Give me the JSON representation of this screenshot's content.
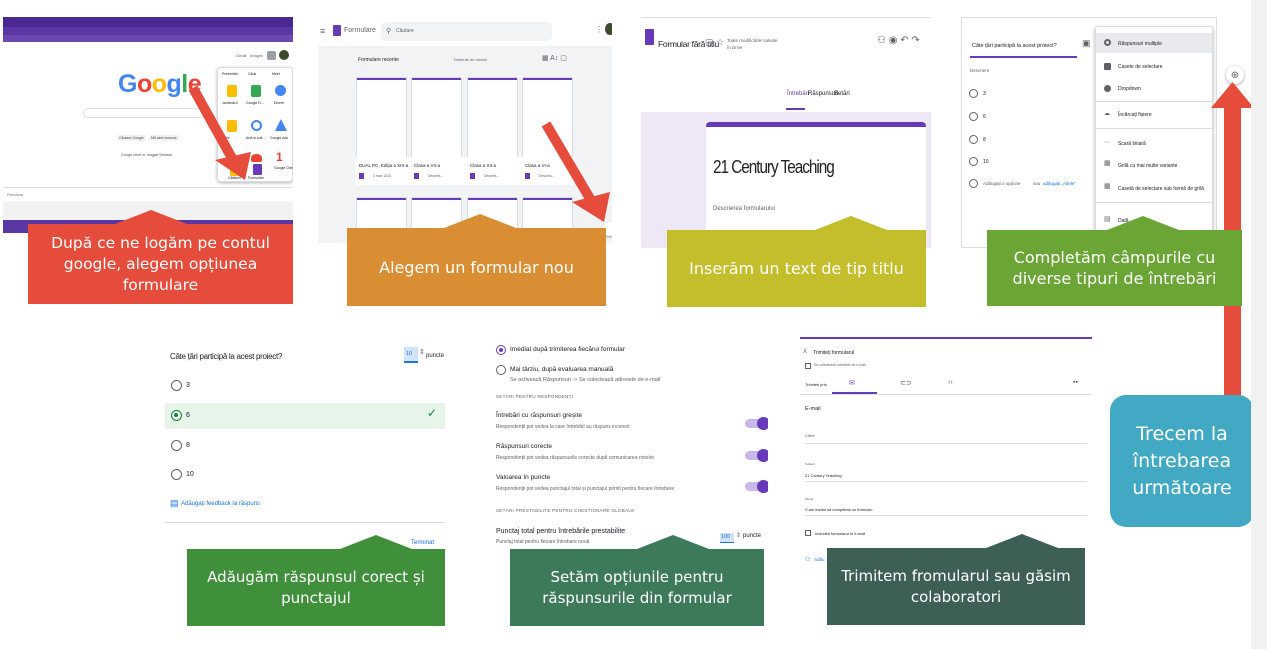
{
  "colors": {
    "red": "#e64c3c",
    "orange": "#d98e33",
    "yellow": "#c4be2c",
    "green": "#6aa535",
    "green2": "#3f8f3b",
    "teal": "#3d7a5a",
    "slate": "#3e5f55",
    "blue": "#42a9c4",
    "purple": "#673ab7"
  },
  "captions": {
    "step1": [
      "După ce ne logăm pe contul",
      "google, alegem opțiunea",
      "formulare"
    ],
    "step2": "Alegem un formular nou",
    "step3": "Inserăm un text de tip titlu",
    "step4": [
      "Completăm câmpurile cu",
      "diverse tipuri de întrebări"
    ],
    "step5": [
      "Trecem la",
      "întrebarea",
      "următoare"
    ],
    "step6": [
      "Adăugăm răspunsul corect și",
      "punctajul"
    ],
    "step7": [
      "Setăm opțiunile pentru",
      "răspunsurile din formular"
    ],
    "step8": [
      "Trimitem fromularul sau găsim",
      "colaboratori"
    ]
  },
  "shot1": {
    "logo": [
      "G",
      "o",
      "o",
      "g",
      "l",
      "e"
    ],
    "search_btn": "Căutare Google",
    "lucky_btn": "Mă simt norocos",
    "lang_text": "Google oferit în: magyar Deutsch",
    "country": "România",
    "apps": [
      "Prezentări",
      "Căuți",
      "Meet",
      "Jamboard",
      "Google D...",
      "Diverti",
      "Hărți",
      "Artă și cult...",
      "Google Ads",
      "Google One",
      "Călătorii",
      "Formulare"
    ],
    "top_links": [
      "Gmail",
      "Imagini"
    ]
  },
  "shot2": {
    "app_name": "Formulare",
    "search_placeholder": "Căutare",
    "section": "Formulare recente",
    "owner_filter": "Deținute de oricine",
    "forms": [
      {
        "title": "DUAL PC, Ediția a XIX-a",
        "date": "3 mar. 2021"
      },
      {
        "title": "Clasa a VII-a",
        "date": "Deschis..."
      },
      {
        "title": "Clasa a XII-a",
        "date": "Deschis..."
      },
      {
        "title": "Clasa a VI-a",
        "date": "Deschis..."
      }
    ]
  },
  "shot3": {
    "doc_title": "Formular fără titlu",
    "save_status": "Toate modificările salvate în Drive",
    "tabs": [
      "Întrebări",
      "Răspunsuri",
      "Setări"
    ],
    "form_title": "21 Century Teaching",
    "form_desc": "Descrierea formularului"
  },
  "shot4": {
    "question": "Câte țări participă la acest proiect?",
    "description": "Descriere",
    "options": [
      "3",
      "6",
      "8",
      "10"
    ],
    "add_option": "Adăugați o opțiune",
    "add_other_sep": "sau",
    "add_other": "adăugați „Altele\"",
    "menu": [
      "Răspunsuri multiple",
      "Casete de selectare",
      "Dropdown",
      "Încărcați fișiere",
      "Scară liniară",
      "Grilă cu mai multe variante",
      "Casetă de selectare sub formă de grilă",
      "Dată"
    ]
  },
  "shot5": {
    "question": "Câte țări participă la acest proiect?",
    "points": "10",
    "points_label": "puncte",
    "options": [
      "3",
      "6",
      "8",
      "10"
    ],
    "correct": "6",
    "feedback": "Adăugați feedback la răspuns",
    "done": "Terminat"
  },
  "shot6": {
    "opt1": "Imediat după trimiterea fiecărui formular",
    "opt2": "Mai târziu, după evaluarea manuală",
    "opt2_sub": "Se activează Răspunsuri -> Se colectează adresele de e-mail",
    "sec1": "SETĂRI PENTRU RESPONDENȚI",
    "items": [
      {
        "title": "Întrebări cu răspunsuri greșite",
        "sub": "Respondenții pot vedea la care întrebări au răspuns incorect"
      },
      {
        "title": "Răspunsuri corecte",
        "sub": "Respondenții pot vedea răspunsurile corecte după comunicarea notelor"
      },
      {
        "title": "Valoarea în puncte",
        "sub": "Respondenții pot vedea punctajul total și punctajul primit pentru fiecare întrebare"
      }
    ],
    "sec2": "SETĂRI PRESTABILITE PENTRU CHESTIONARE GLOBALE",
    "default_title": "Punctaj total pentru întrebările prestabilite",
    "default_sub": "Punctaj total pentru fiecare întrebare nouă",
    "default_val": "100",
    "default_unit": "puncte"
  },
  "shot7": {
    "header": "Trimiteți formularul",
    "collect": "Se colectează adresele de e-mail",
    "send_via": "Trimiteți prin",
    "email": "E-mail",
    "to": "Către",
    "subject_label": "Subiect",
    "subject": "21 Century Teaching",
    "message_label": "Mesaj",
    "message": "V-am invitat să completați un formular:",
    "include": "Includeți formularul în e-mail",
    "add": "Adău"
  }
}
